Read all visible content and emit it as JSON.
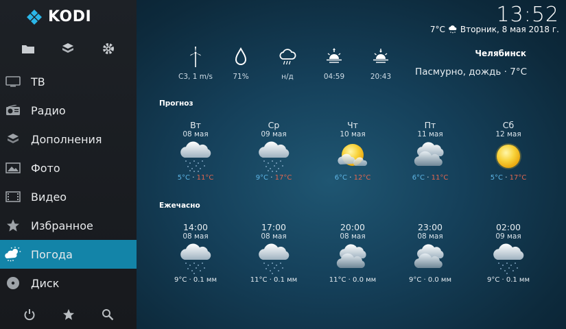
{
  "app": {
    "logo_text": "KODI"
  },
  "clock": {
    "time": "13:52",
    "temp": "7°C",
    "date": "Вторник, 8 мая 2018 г."
  },
  "nav": [
    {
      "label": "ТВ",
      "icon": "tv-icon",
      "active": false
    },
    {
      "label": "Радио",
      "icon": "radio-icon",
      "active": false
    },
    {
      "label": "Дополнения",
      "icon": "addons-icon",
      "active": false
    },
    {
      "label": "Фото",
      "icon": "photo-icon",
      "active": false
    },
    {
      "label": "Видео",
      "icon": "video-icon",
      "active": false
    },
    {
      "label": "Избранное",
      "icon": "star-icon",
      "active": false
    },
    {
      "label": "Погода",
      "icon": "weather-icon",
      "active": true
    },
    {
      "label": "Диск",
      "icon": "disc-icon",
      "active": false
    }
  ],
  "current": {
    "wind": "С3, 1 m/s",
    "humidity": "71%",
    "precip": "н/д",
    "sunrise": "04:59",
    "sunset": "20:43",
    "city": "Челябинск",
    "condition": "Пасмурно,  дождь · 7°С"
  },
  "forecast": {
    "title": "Прогноз",
    "days": [
      {
        "day": "Вт",
        "date": "08 мая",
        "icon": "rain-cloud-icon",
        "low": "5°C",
        "high": "11°C"
      },
      {
        "day": "Ср",
        "date": "09 мая",
        "icon": "rain-cloud-icon",
        "low": "9°C",
        "high": "17°C"
      },
      {
        "day": "Чт",
        "date": "10 мая",
        "icon": "sun-cloud-icon",
        "low": "6°C",
        "high": "12°C"
      },
      {
        "day": "Пт",
        "date": "11 мая",
        "icon": "cloud-icon",
        "low": "6°C",
        "high": "11°C"
      },
      {
        "day": "Сб",
        "date": "12 мая",
        "icon": "sun-icon",
        "low": "5°C",
        "high": "17°C"
      }
    ]
  },
  "hourly": {
    "title": "Ежечасно",
    "hours": [
      {
        "time": "14:00",
        "date": "08 мая",
        "icon": "rain-cloud-icon",
        "info": "9°C · 0.1 мм"
      },
      {
        "time": "17:00",
        "date": "08 мая",
        "icon": "rain-cloud-icon",
        "info": "11°C · 0.1 мм"
      },
      {
        "time": "20:00",
        "date": "08 мая",
        "icon": "cloud-icon",
        "info": "11°C · 0.0 мм"
      },
      {
        "time": "23:00",
        "date": "08 мая",
        "icon": "cloud-icon",
        "info": "9°C · 0.0 мм"
      },
      {
        "time": "02:00",
        "date": "09 мая",
        "icon": "rain-cloud-icon",
        "info": "9°C · 0.1 мм"
      }
    ]
  },
  "colors": {
    "accent": "#1384a8",
    "low_temp": "#5fb6e6",
    "high_temp": "#e2674f"
  }
}
